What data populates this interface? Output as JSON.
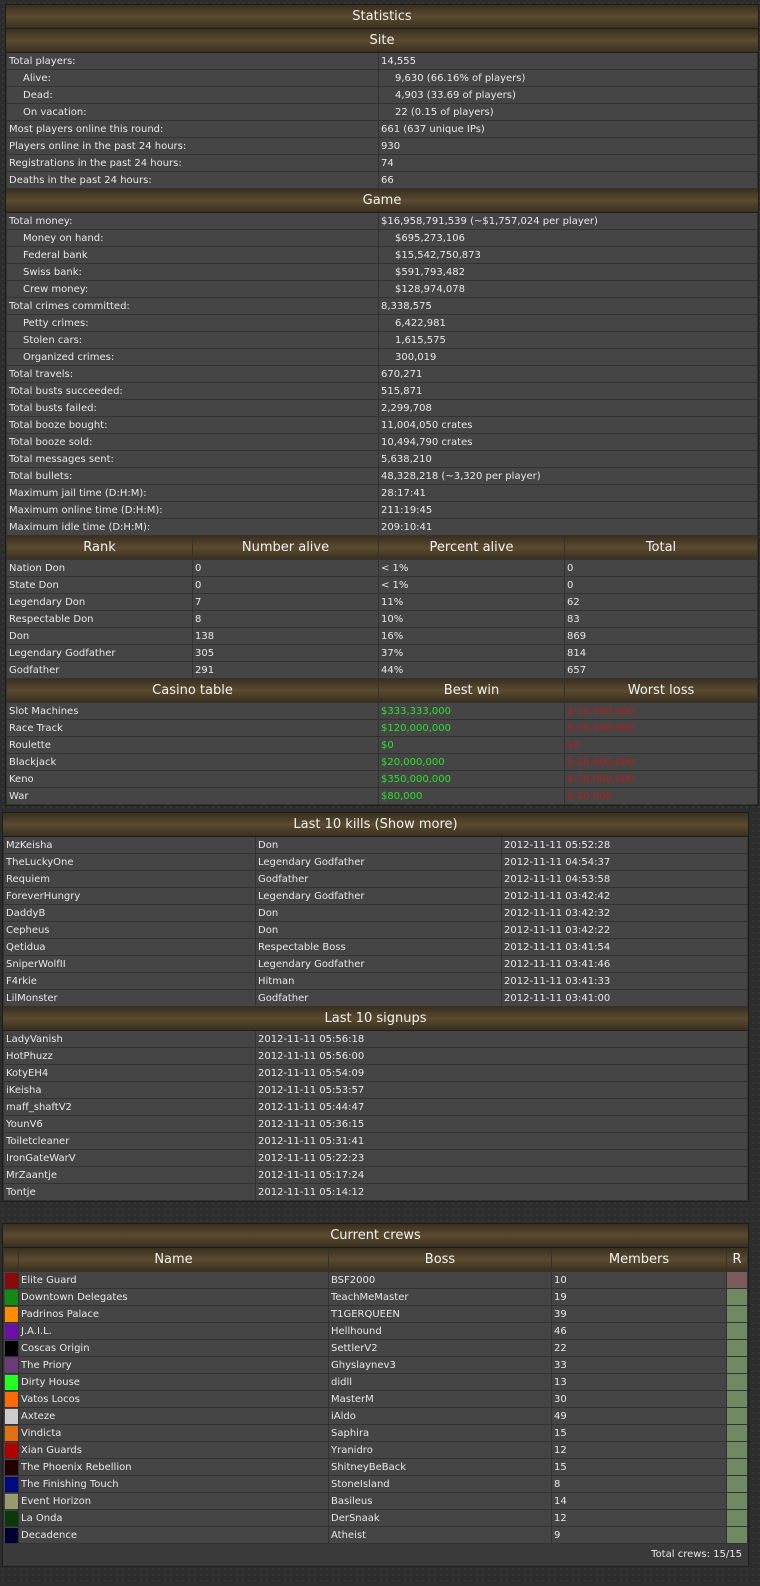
{
  "statistics": {
    "title": "Statistics",
    "site_title": "Site",
    "site_rows": [
      {
        "label": "Total players:",
        "value": "14,555",
        "indent": false
      },
      {
        "label": "Alive:",
        "value": "9,630 (66.16% of players)",
        "indent": true
      },
      {
        "label": "Dead:",
        "value": "4,903 (33.69 of players)",
        "indent": true
      },
      {
        "label": "On vacation:",
        "value": "22 (0.15 of players)",
        "indent": true
      },
      {
        "label": "Most players online this round:",
        "value": "661 (637 unique IPs)",
        "indent": false
      },
      {
        "label": "Players online in the past 24 hours:",
        "value": "930",
        "indent": false
      },
      {
        "label": "Registrations in the past 24 hours:",
        "value": "74",
        "indent": false
      },
      {
        "label": "Deaths in the past 24 hours:",
        "value": "66",
        "indent": false
      }
    ],
    "game_title": "Game",
    "game_rows": [
      {
        "label": "Total money:",
        "value": "$16,958,791,539 (~$1,757,024 per player)",
        "indent": false
      },
      {
        "label": "Money on hand:",
        "value": "$695,273,106",
        "indent": true
      },
      {
        "label": "Federal bank",
        "value": "$15,542,750,873",
        "indent": true
      },
      {
        "label": "Swiss bank:",
        "value": "$591,793,482",
        "indent": true
      },
      {
        "label": "Crew money:",
        "value": "$128,974,078",
        "indent": true
      },
      {
        "label": "Total crimes committed:",
        "value": "8,338,575",
        "indent": false
      },
      {
        "label": "Petty crimes:",
        "value": "6,422,981",
        "indent": true
      },
      {
        "label": "Stolen cars:",
        "value": "1,615,575",
        "indent": true
      },
      {
        "label": "Organized crimes:",
        "value": "300,019",
        "indent": true
      },
      {
        "label": "Total travels:",
        "value": "670,271",
        "indent": false
      },
      {
        "label": "Total busts succeeded:",
        "value": "515,871",
        "indent": false
      },
      {
        "label": "Total busts failed:",
        "value": "2,299,708",
        "indent": false
      },
      {
        "label": "Total booze bought:",
        "value": "11,004,050 crates",
        "indent": false
      },
      {
        "label": "Total booze sold:",
        "value": "10,494,790 crates",
        "indent": false
      },
      {
        "label": "Total messages sent:",
        "value": "5,638,210",
        "indent": false
      },
      {
        "label": "Total bullets:",
        "value": "48,328,218 (~3,320 per player)",
        "indent": false
      },
      {
        "label": "Maximum jail time (D:H:M):",
        "value": "28:17:41",
        "indent": false
      },
      {
        "label": "Maximum online time (D:H:M):",
        "value": "211:19:45",
        "indent": false
      },
      {
        "label": "Maximum idle time (D:H:M):",
        "value": "209:10:41",
        "indent": false
      }
    ],
    "rank_headers": [
      "Rank",
      "Number alive",
      "Percent alive",
      "Total"
    ],
    "rank_rows": [
      [
        "Nation Don",
        "0",
        "< 1%",
        "0"
      ],
      [
        "State Don",
        "0",
        "< 1%",
        "0"
      ],
      [
        "Legendary Don",
        "7",
        "11%",
        "62"
      ],
      [
        "Respectable Don",
        "8",
        "10%",
        "83"
      ],
      [
        "Don",
        "138",
        "16%",
        "869"
      ],
      [
        "Legendary Godfather",
        "305",
        "37%",
        "814"
      ],
      [
        "Godfather",
        "291",
        "44%",
        "657"
      ]
    ],
    "casino_headers": [
      "Casino table",
      "Best win",
      "Worst loss"
    ],
    "casino_rows": [
      [
        "Slot Machines",
        "$333,333,000",
        "$-20,000,000"
      ],
      [
        "Race Track",
        "$120,000,000",
        "$-35,000,000"
      ],
      [
        "Roulette",
        "$0",
        "$0"
      ],
      [
        "Blackjack",
        "$20,000,000",
        "$-20,000,000"
      ],
      [
        "Keno",
        "$350,000,000",
        "$-20,000,000"
      ],
      [
        "War",
        "$80,000",
        "$-20,000"
      ]
    ]
  },
  "kills": {
    "title": "Last 10 kills (Show more)",
    "rows": [
      [
        "MzKeisha",
        "Don",
        "2012-11-11 05:52:28"
      ],
      [
        "TheLuckyOne",
        "Legendary Godfather",
        "2012-11-11 04:54:37"
      ],
      [
        "Requiem",
        "Godfather",
        "2012-11-11 04:53:58"
      ],
      [
        "ForeverHungry",
        "Legendary Godfather",
        "2012-11-11 03:42:42"
      ],
      [
        "DaddyB",
        "Don",
        "2012-11-11 03:42:32"
      ],
      [
        "Cepheus",
        "Don",
        "2012-11-11 03:42:22"
      ],
      [
        "Qetidua",
        "Respectable Boss",
        "2012-11-11 03:41:54"
      ],
      [
        "SniperWolfII",
        "Legendary Godfather",
        "2012-11-11 03:41:46"
      ],
      [
        "F4rkie",
        "Hitman",
        "2012-11-11 03:41:33"
      ],
      [
        "LilMonster",
        "Godfather",
        "2012-11-11 03:41:00"
      ]
    ]
  },
  "signups": {
    "title": "Last 10 signups",
    "rows": [
      [
        "LadyVanish",
        "2012-11-11 05:56:18"
      ],
      [
        "HotPhuzz",
        "2012-11-11 05:56:00"
      ],
      [
        "KotyEH4",
        "2012-11-11 05:54:09"
      ],
      [
        "iKeisha",
        "2012-11-11 05:53:57"
      ],
      [
        "maff_shaftV2",
        "2012-11-11 05:44:47"
      ],
      [
        "YounV6",
        "2012-11-11 05:36:15"
      ],
      [
        "Toiletcleaner",
        "2012-11-11 05:31:41"
      ],
      [
        "IronGateWarV",
        "2012-11-11 05:22:23"
      ],
      [
        "MrZaantje",
        "2012-11-11 05:17:24"
      ],
      [
        "Tontje",
        "2012-11-11 05:14:12"
      ]
    ]
  },
  "crews": {
    "title": "Current crews",
    "headers": [
      "Name",
      "Boss",
      "Members",
      "R"
    ],
    "rows": [
      {
        "color": "#8a0a0a",
        "name": "Elite Guard",
        "boss": "BSF2000",
        "members": "10",
        "rcolor": "#7a5a5a"
      },
      {
        "color": "#138a13",
        "name": "Downtown Delegates",
        "boss": "TeachMeMaster",
        "members": "19",
        "rcolor": "#6f8a63"
      },
      {
        "color": "#ff8c00",
        "name": "Padrinos Palace",
        "boss": "T1GERQUEEN",
        "members": "39",
        "rcolor": "#6f8a63"
      },
      {
        "color": "#6a0fa8",
        "name": "J.A.I.L.",
        "boss": "Hellhound",
        "members": "46",
        "rcolor": "#6f8a63"
      },
      {
        "color": "#000000",
        "name": "Coscas Origin",
        "boss": "SettlerV2",
        "members": "22",
        "rcolor": "#6f8a63"
      },
      {
        "color": "#6a3a7a",
        "name": "The Priory",
        "boss": "Ghyslaynev3",
        "members": "33",
        "rcolor": "#6f8a63"
      },
      {
        "color": "#22ff22",
        "name": "Dirty House",
        "boss": "didll",
        "members": "13",
        "rcolor": "#6f8a63"
      },
      {
        "color": "#ff6a00",
        "name": "Vatos Locos",
        "boss": "MasterM",
        "members": "30",
        "rcolor": "#6f8a63"
      },
      {
        "color": "#cccccc",
        "name": "Axteze",
        "boss": "iAldo",
        "members": "49",
        "rcolor": "#6f8a63"
      },
      {
        "color": "#e07010",
        "name": "Vindicta",
        "boss": "Saphira",
        "members": "15",
        "rcolor": "#6f8a63"
      },
      {
        "color": "#b00000",
        "name": "Xian Guards",
        "boss": "Yranidro",
        "members": "12",
        "rcolor": "#6f8a63"
      },
      {
        "color": "#200000",
        "name": "The Phoenix Rebellion",
        "boss": "ShitneyBeBack",
        "members": "15",
        "rcolor": "#6f8a63"
      },
      {
        "color": "#000a80",
        "name": "The Finishing Touch",
        "boss": "StoneIsland",
        "members": "8",
        "rcolor": "#6f8a63"
      },
      {
        "color": "#9a9a70",
        "name": "Event Horizon",
        "boss": "Basileus",
        "members": "14",
        "rcolor": "#6f8a63"
      },
      {
        "color": "#0a3a0a",
        "name": "La Onda",
        "boss": "DerSnaak",
        "members": "12",
        "rcolor": "#6f8a63"
      },
      {
        "color": "#000030",
        "name": "Decadence",
        "boss": "Atheist",
        "members": "9",
        "rcolor": "#6f8a63"
      }
    ],
    "footer": "Total crews: 15/15"
  }
}
